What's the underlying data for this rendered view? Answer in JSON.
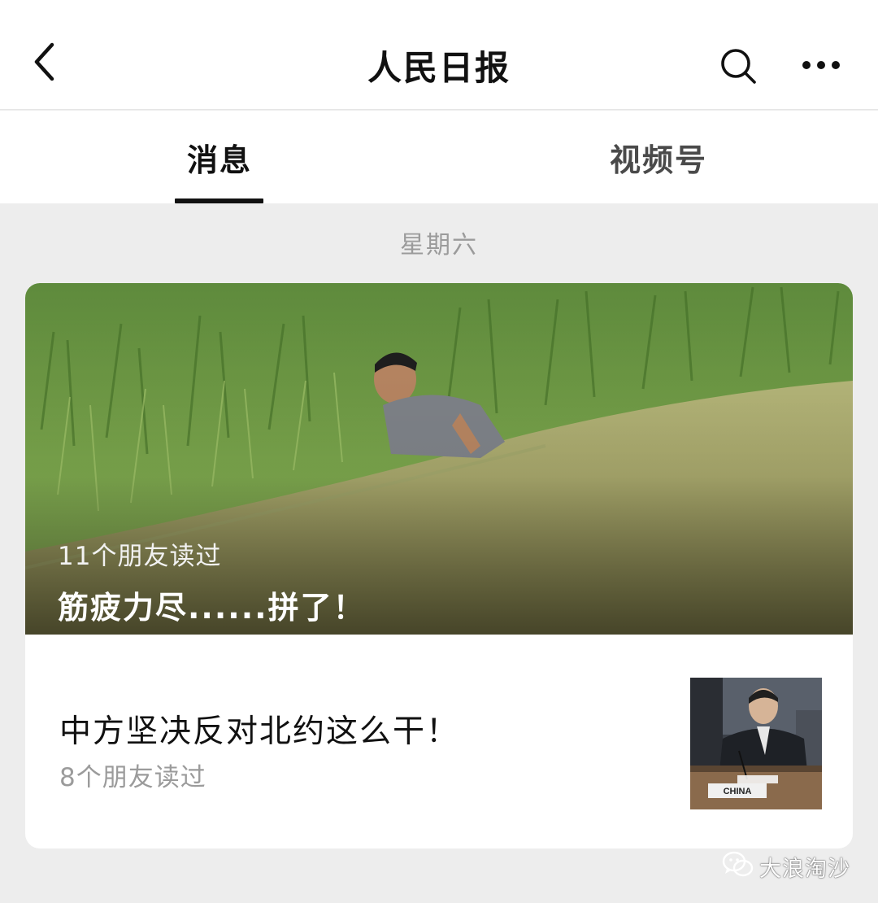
{
  "header": {
    "title": "人民日报",
    "back_icon": "chevron-left-icon",
    "search_icon": "search-icon",
    "more_icon": "more-dots-icon"
  },
  "tabs": [
    {
      "label": "消息",
      "active": true
    },
    {
      "label": "视频号",
      "active": false
    }
  ],
  "feed": {
    "date_label": "星期六",
    "card": {
      "hero": {
        "readers": "11个朋友读过",
        "title": "筋疲力尽......拼了！"
      },
      "article": {
        "title": "中方坚决反对北约这么干！",
        "readers": "8个朋友读过",
        "thumbnail_label": "CHINA"
      }
    }
  },
  "watermark": {
    "text": "大浪淘沙"
  },
  "colors": {
    "background": "#ededed",
    "surface": "#ffffff",
    "text_primary": "#111111",
    "text_secondary": "#9b9b9b"
  }
}
